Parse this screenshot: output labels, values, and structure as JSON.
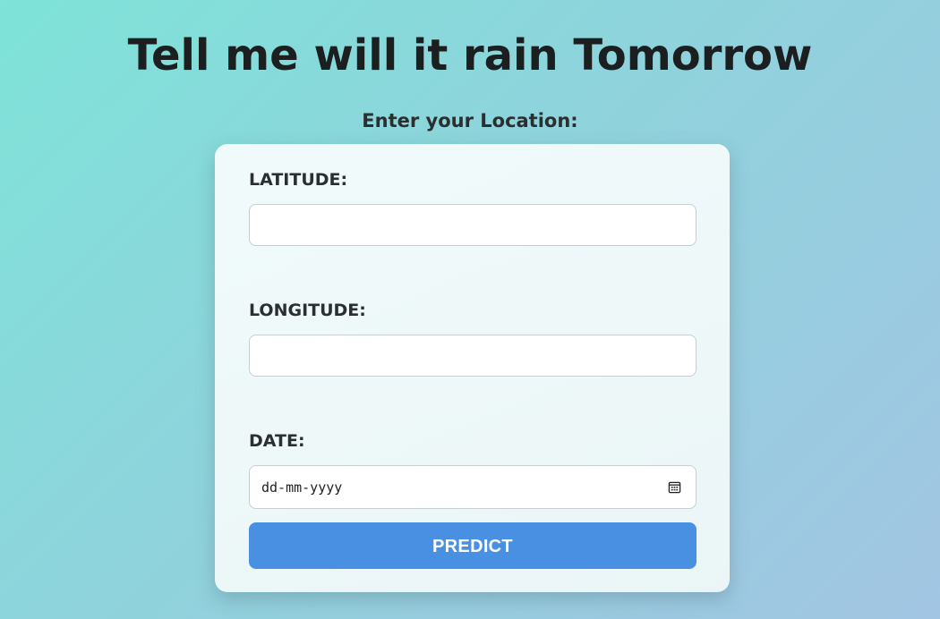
{
  "page": {
    "title": "Tell me will it rain Tomorrow",
    "subtitle": "Enter your Location:"
  },
  "form": {
    "latitude": {
      "label": "LATITUDE:",
      "value": ""
    },
    "longitude": {
      "label": "LONGITUDE:",
      "value": ""
    },
    "date": {
      "label": "DATE:",
      "placeholder": "dd-mm-yyyy",
      "icon": "calendar-icon"
    },
    "submit_label": "PREDICT"
  },
  "colors": {
    "button": "#4a90e2",
    "title_text": "#1c1f1f"
  }
}
